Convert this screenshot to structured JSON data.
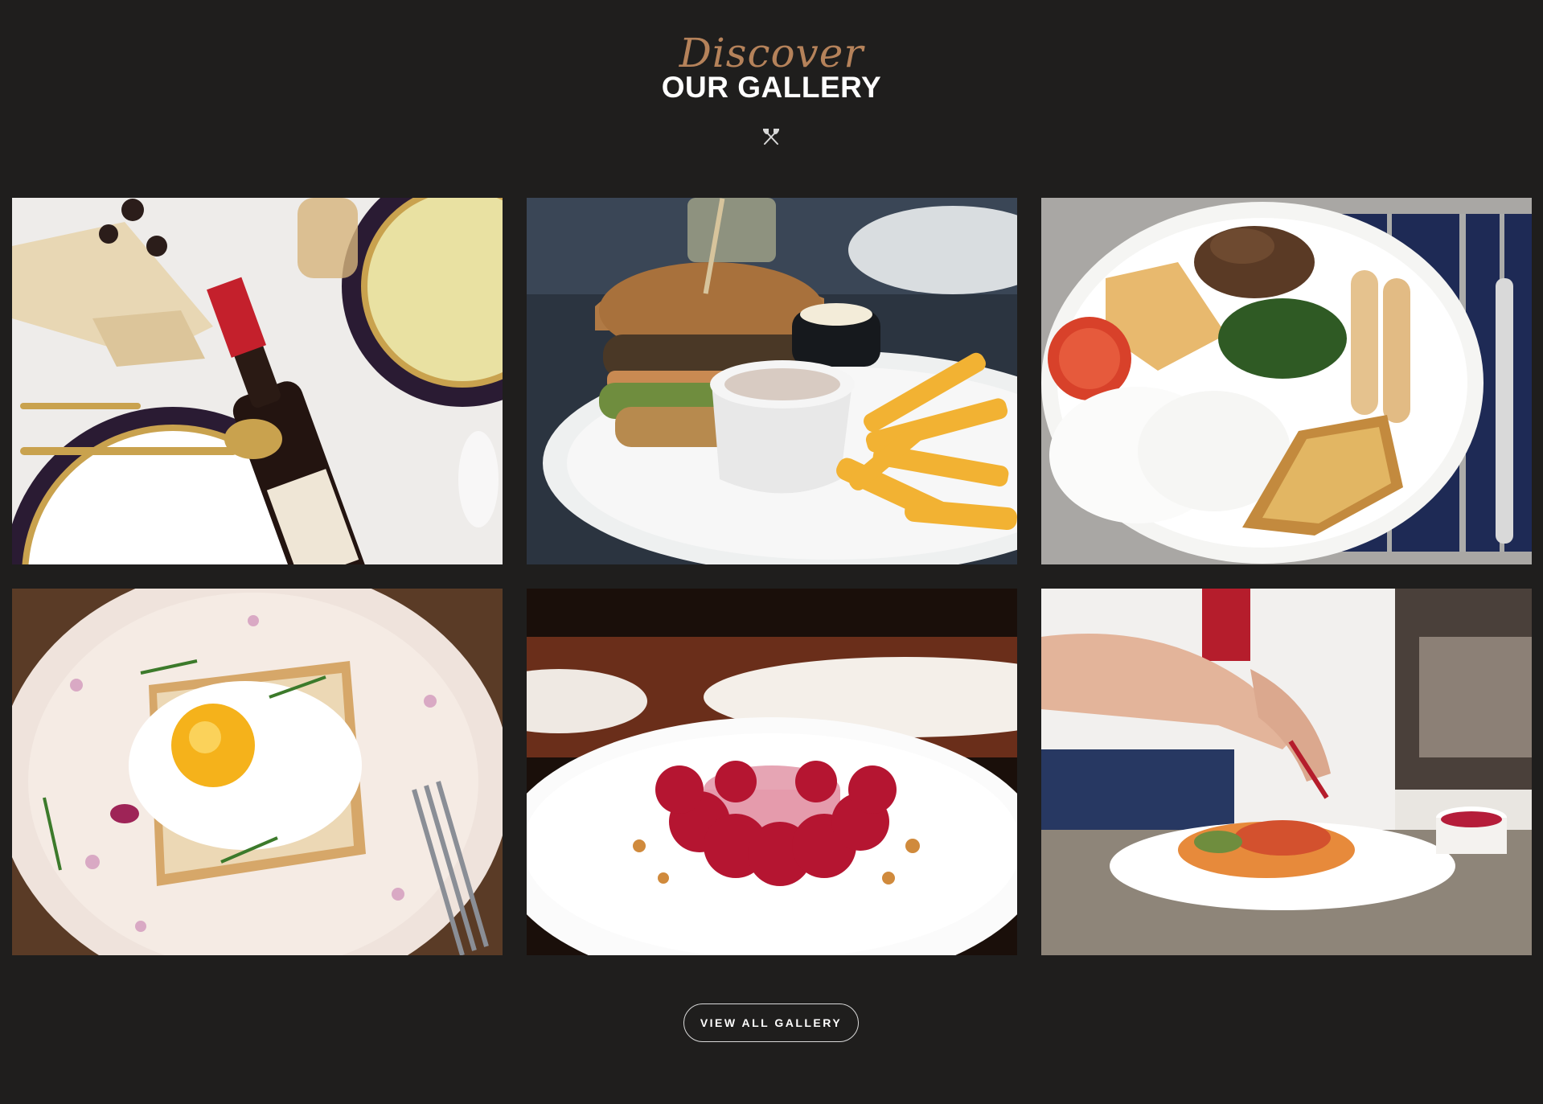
{
  "header": {
    "script_title": "Discover",
    "main_title": "OUR GALLERY",
    "divider_icon": "fork-knife-icon"
  },
  "gallery": {
    "items": [
      {
        "subject": "wine-cheese-table"
      },
      {
        "subject": "burger-fries"
      },
      {
        "subject": "breakfast-plate"
      },
      {
        "subject": "fried-egg-toast"
      },
      {
        "subject": "raspberry-dessert"
      },
      {
        "subject": "chef-plating"
      }
    ]
  },
  "actions": {
    "view_all_label": "VIEW ALL GALLERY"
  },
  "colors": {
    "background": "#1f1e1d",
    "accent": "#b5825a",
    "heading": "#ffffff"
  }
}
